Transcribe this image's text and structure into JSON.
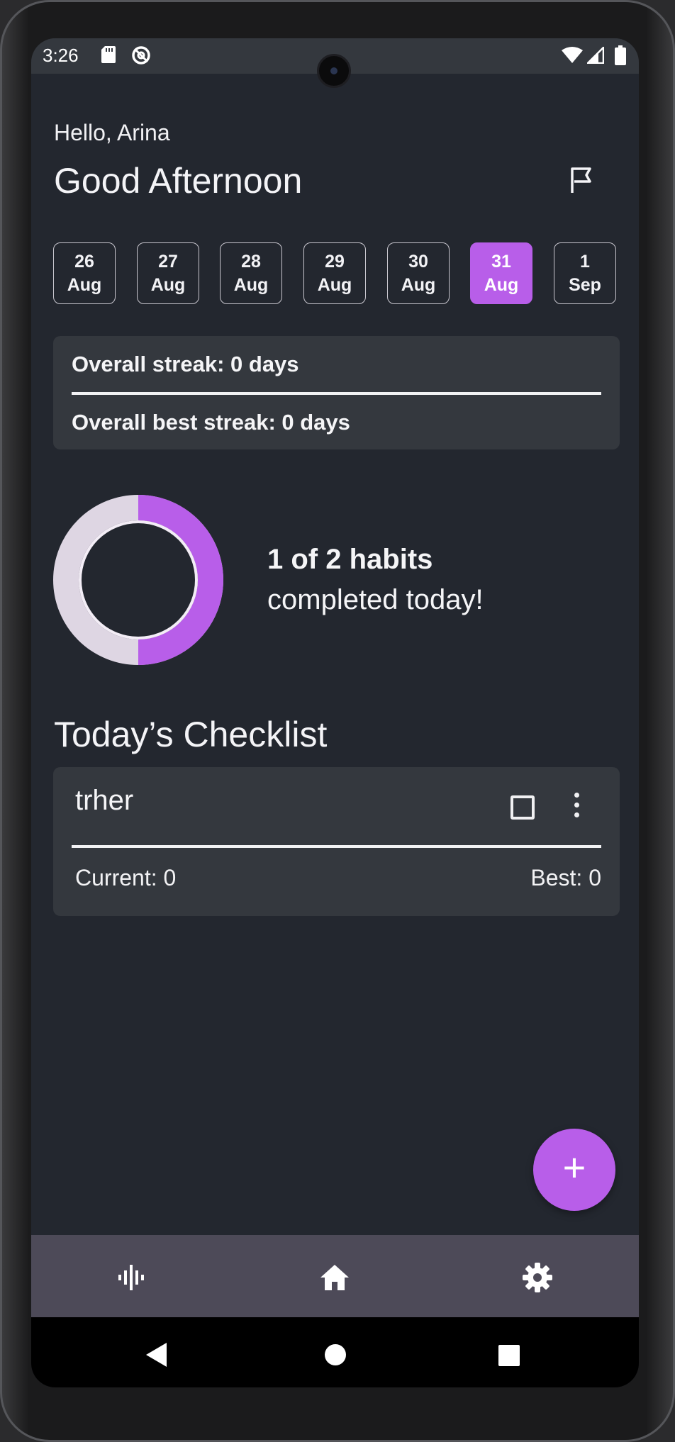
{
  "status_bar": {
    "time": "3:26",
    "icons": [
      "sd-card-icon",
      "data-saver-icon",
      "wifi-icon",
      "signal-icon",
      "battery-icon"
    ]
  },
  "header": {
    "greeting": "Hello, Arina",
    "title": "Good Afternoon",
    "flag_icon": "flag-icon"
  },
  "dates": [
    {
      "day": "26",
      "month": "Aug",
      "selected": false
    },
    {
      "day": "27",
      "month": "Aug",
      "selected": false
    },
    {
      "day": "28",
      "month": "Aug",
      "selected": false
    },
    {
      "day": "29",
      "month": "Aug",
      "selected": false
    },
    {
      "day": "30",
      "month": "Aug",
      "selected": false
    },
    {
      "day": "31",
      "month": "Aug",
      "selected": true
    },
    {
      "day": "1",
      "month": "Sep",
      "selected": false
    }
  ],
  "streaks": {
    "overall": "Overall streak: 0 days",
    "best": "Overall best streak: 0 days"
  },
  "progress": {
    "completed": 1,
    "total": 2,
    "line1": "1 of 2 habits",
    "line2": "completed today!"
  },
  "checklist": {
    "title": "Today’s Checklist",
    "items": [
      {
        "name": "trher",
        "checked": false,
        "current": "Current: 0",
        "best": "Best: 0"
      }
    ]
  },
  "fab": {
    "label": "+",
    "icon": "add-icon"
  },
  "bottom_nav": {
    "items": [
      "stats-icon",
      "home-icon",
      "settings-icon"
    ]
  },
  "colors": {
    "accent": "#b85ee9",
    "background": "#23272f",
    "surface": "#34383e",
    "ring_track": "#ded6e3",
    "nav_bar": "#4d4a58"
  }
}
